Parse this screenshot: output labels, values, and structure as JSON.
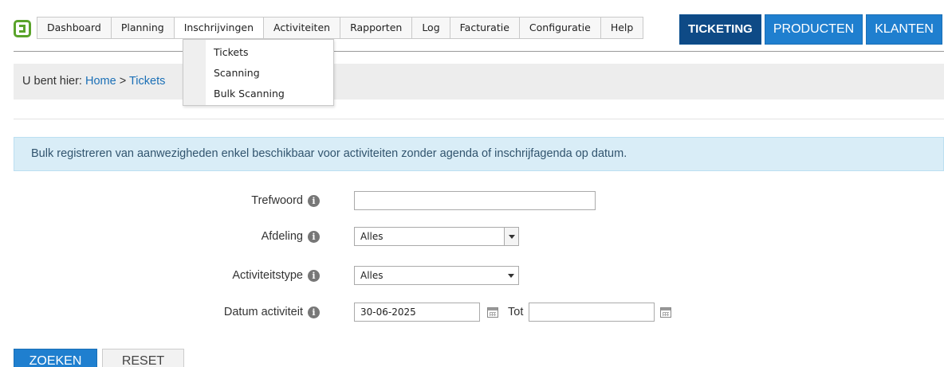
{
  "nav": {
    "items": [
      "Dashboard",
      "Planning",
      "Inschrijvingen",
      "Activiteiten",
      "Rapporten",
      "Log",
      "Facturatie",
      "Configuratie",
      "Help"
    ],
    "active_index": 2,
    "big_buttons": [
      "TICKETING",
      "PRODUCTEN",
      "KLANTEN"
    ]
  },
  "dropdown": {
    "items": [
      "Tickets",
      "Scanning",
      "Bulk Scanning"
    ]
  },
  "breadcrumb": {
    "prefix": "U bent hier:",
    "home": "Home",
    "separator": ">",
    "current": "Tickets"
  },
  "info_banner": "Bulk registreren van aanwezigheden enkel beschikbaar voor activiteiten zonder agenda of inschrijfagenda op datum.",
  "form": {
    "keyword_label": "Trefwoord",
    "keyword_value": "",
    "department_label": "Afdeling",
    "department_value": "Alles",
    "activity_type_label": "Activiteitstype",
    "activity_type_value": "Alles",
    "date_label": "Datum activiteit",
    "date_from": "30-06-2025",
    "date_to_label": "Tot",
    "date_to": ""
  },
  "buttons": {
    "search": "ZOEKEN",
    "reset": "RESET"
  },
  "colors": {
    "primary_blue": "#1f7fcf",
    "dark_blue": "#0e4a86",
    "logo_green": "#5aa32a",
    "info_bg": "#d9edf7"
  }
}
